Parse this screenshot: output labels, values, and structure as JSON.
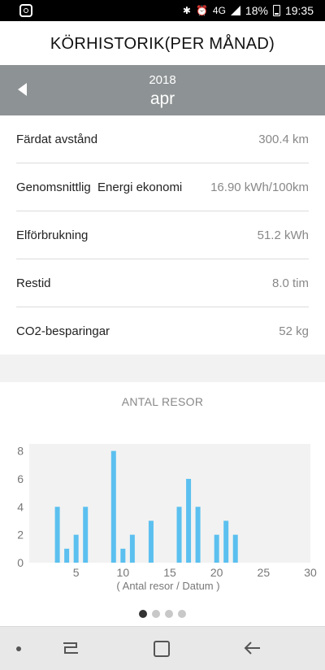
{
  "status_bar": {
    "battery": "18%",
    "time": "19:35",
    "network": "4G"
  },
  "header": {
    "title": "KÖRHISTORIK(PER MÅNAD)"
  },
  "period": {
    "year": "2018",
    "month": "apr"
  },
  "stats": [
    {
      "label": "Färdat avstånd",
      "value": "300.4 km"
    },
    {
      "label": "Genomsnittlig  Energi ekonomi",
      "value": "16.90 kWh/100km"
    },
    {
      "label": "Elförbrukning",
      "value": "51.2 kWh"
    },
    {
      "label": "Restid",
      "value": "8.0 tim"
    },
    {
      "label": "CO2-besparingar",
      "value": "52 kg"
    }
  ],
  "chart_section": {
    "title": "ANTAL RESOR"
  },
  "pager": {
    "pages": 4,
    "active": 0
  },
  "chart_data": {
    "type": "bar",
    "title": "ANTAL RESOR",
    "xlabel": "( Antal resor / Datum )",
    "ylabel": "",
    "x": [
      3,
      4,
      5,
      6,
      9,
      10,
      11,
      13,
      16,
      17,
      18,
      20,
      21,
      22
    ],
    "values": [
      4,
      1,
      2,
      4,
      8,
      1,
      2,
      3,
      4,
      6,
      4,
      2,
      3,
      2
    ],
    "xlim": [
      0,
      30
    ],
    "ylim": [
      0,
      8.5
    ],
    "xticks": [
      5,
      10,
      15,
      20,
      25,
      30
    ],
    "yticks": [
      0,
      2,
      4,
      6,
      8
    ],
    "bar_color": "#5bc0ef",
    "grid": false
  }
}
